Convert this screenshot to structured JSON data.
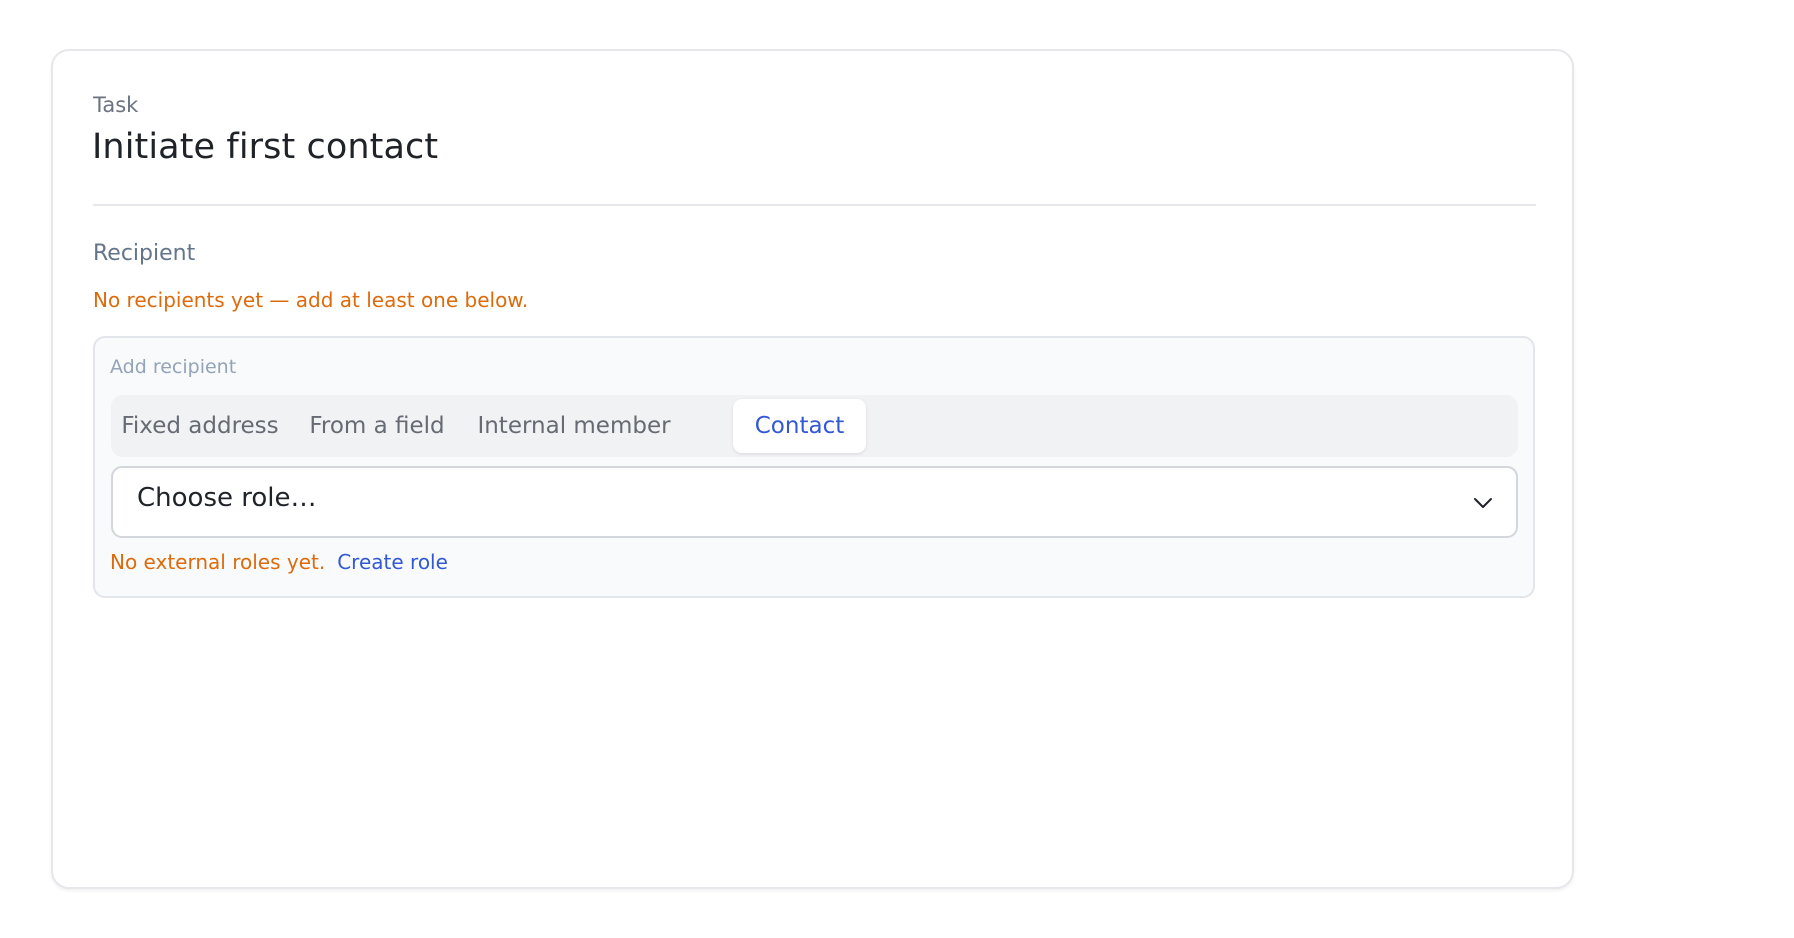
{
  "task": {
    "eyebrow": "Task",
    "title": "Initiate first contact"
  },
  "recipient": {
    "label": "Recipient",
    "warning": "No recipients yet — add at least one below."
  },
  "add_recipient": {
    "label": "Add recipient",
    "tabs": [
      {
        "label": "Fixed address",
        "active": false
      },
      {
        "label": "From a field",
        "active": false
      },
      {
        "label": "Internal member",
        "active": false
      },
      {
        "label": "Contact",
        "active": true
      }
    ],
    "select": {
      "value": "Choose role…",
      "icon": "chevron-down-icon"
    },
    "footer": {
      "warning": "No external roles yet.",
      "link": "Create role"
    }
  },
  "colors": {
    "accent": "#3358d4",
    "warning": "#dd6b0c",
    "muted": "#64748b"
  }
}
